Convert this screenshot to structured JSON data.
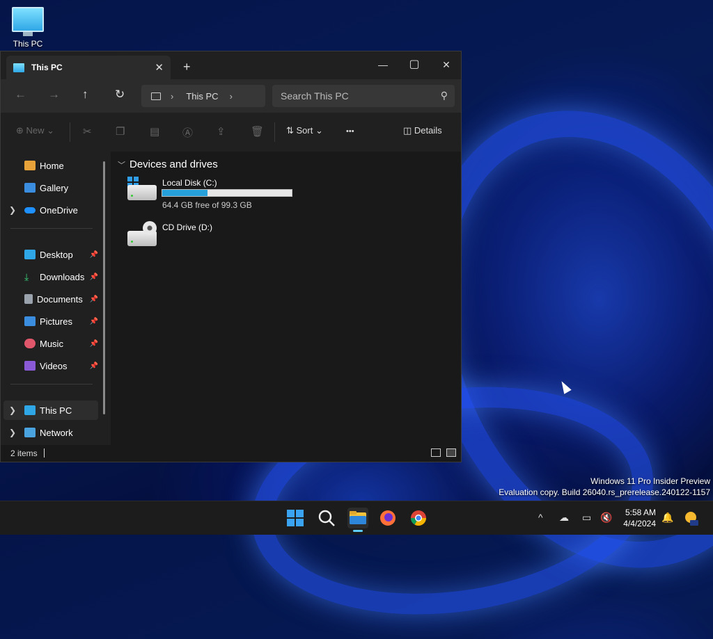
{
  "desktop": {
    "icon_label": "This PC"
  },
  "window": {
    "tab_title": "This PC",
    "close_tab": "✕",
    "new_tab": "+",
    "minimize": "—",
    "maximize": "▢",
    "close": "✕"
  },
  "nav": {
    "back": "←",
    "forward": "→",
    "up": "↑",
    "refresh": "↻",
    "breadcrumb": "This PC",
    "chevron": "›",
    "search_placeholder": "Search This PC",
    "search_icon": "⚲"
  },
  "commands": {
    "new_label": "New",
    "sort_label": "Sort",
    "more_label": "•••",
    "details_label": "Details"
  },
  "sidebar": {
    "items": [
      {
        "label": "Home",
        "icon": "home-icon"
      },
      {
        "label": "Gallery",
        "icon": "gallery-icon"
      },
      {
        "label": "OneDrive",
        "icon": "cloud-icon"
      },
      {
        "label": "Desktop",
        "icon": "desktop-folder-icon"
      },
      {
        "label": "Downloads",
        "icon": "download-icon"
      },
      {
        "label": "Documents",
        "icon": "document-icon"
      },
      {
        "label": "Pictures",
        "icon": "pictures-icon"
      },
      {
        "label": "Music",
        "icon": "music-icon"
      },
      {
        "label": "Videos",
        "icon": "videos-icon"
      },
      {
        "label": "This PC",
        "icon": "computer-icon"
      },
      {
        "label": "Network",
        "icon": "network-icon"
      }
    ]
  },
  "content": {
    "group_title": "Devices and drives",
    "drives": [
      {
        "name": "Local Disk (C:)",
        "free_text": "64.4 GB free of 99.3 GB",
        "used_fraction": 0.35
      },
      {
        "name": "CD Drive (D:)"
      }
    ]
  },
  "status": {
    "count": "2 items"
  },
  "watermark": {
    "line1": "Windows 11 Pro Insider Preview",
    "line2": "Evaluation copy. Build 26040.rs_prerelease.240122-1157"
  },
  "taskbar": {
    "time": "5:58 AM",
    "date": "4/4/2024",
    "tray_chevron": "^"
  },
  "colors": {
    "accent": "#26a0da",
    "window_bg": "#191919",
    "taskbar_bg": "#1c1c1c"
  }
}
